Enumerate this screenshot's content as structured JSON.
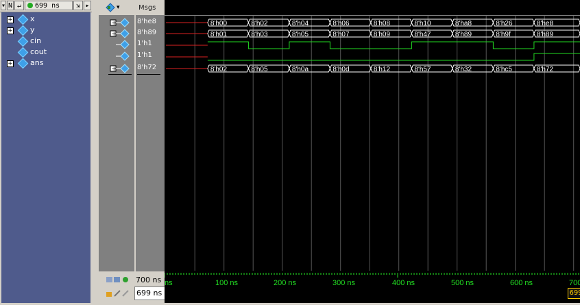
{
  "toolbar": {
    "n_label": "N",
    "time_value": "699 ns"
  },
  "objects": [
    {
      "name": "x",
      "expandable": true
    },
    {
      "name": "y",
      "expandable": true
    },
    {
      "name": "cin",
      "expandable": false
    },
    {
      "name": "cout",
      "expandable": false
    },
    {
      "name": "ans",
      "expandable": true
    }
  ],
  "wave_panel": {
    "msgs_header": "Msgs",
    "signals": [
      {
        "value": "8'he8",
        "expandable": true
      },
      {
        "value": "8'h89",
        "expandable": true
      },
      {
        "value": "1'h1",
        "expandable": false
      },
      {
        "value": "1'h1",
        "expandable": false
      },
      {
        "value": "8'h72",
        "expandable": true
      }
    ],
    "now_label": "700 ns",
    "cursor_label": "699 ns"
  },
  "waveforms": {
    "x": [
      "8'h00",
      "8'h02",
      "8'h04",
      "8'h06",
      "8'h08",
      "8'h10",
      "8'ha8",
      "8'h26",
      "8'he8"
    ],
    "y": [
      "8'h01",
      "8'h03",
      "8'h05",
      "8'h07",
      "8'h09",
      "8'h47",
      "8'h89",
      "8'h9f",
      "8'h89"
    ],
    "ans": [
      "8'h02",
      "8'h05",
      "8'h0a",
      "8'h0d",
      "8'h12",
      "8'h57",
      "8'h32",
      "8'hc5",
      "8'h72"
    ]
  },
  "time_axis": {
    "labels": [
      "ns",
      "100 ns",
      "200 ns",
      "300 ns",
      "400 ns",
      "500 ns",
      "600 ns",
      "700"
    ],
    "cursor_readout": "699"
  },
  "colors": {
    "bus": "#ffffff",
    "logic": "#22dd22",
    "wire": "#dd2222",
    "background": "#000000",
    "cursor": "#ffcc00"
  }
}
